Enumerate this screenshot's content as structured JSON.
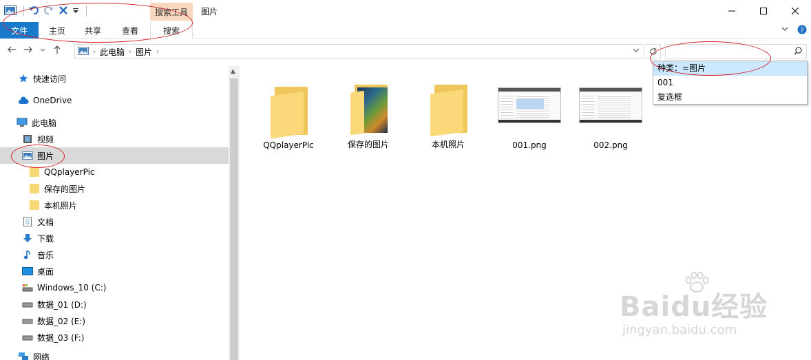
{
  "window": {
    "title": "图片",
    "context_tab_group": "搜索工具",
    "controls": [
      "minimize-icon",
      "maximize-icon",
      "close-icon"
    ]
  },
  "quick_access_toolbar": {
    "icons": [
      "app-icon",
      "undo-icon",
      "redo-icon",
      "delete-icon",
      "customize-dropdown-icon"
    ]
  },
  "ribbon": {
    "tabs": [
      {
        "label": "文件",
        "active": false
      },
      {
        "label": "主页"
      },
      {
        "label": "共享"
      },
      {
        "label": "查看"
      },
      {
        "label": "搜索"
      }
    ],
    "right_icons": [
      "ribbon-expand-icon",
      "help-icon"
    ]
  },
  "address_bar": {
    "crumbs": [
      "此电脑",
      "图片"
    ]
  },
  "search": {
    "value": "",
    "placeholder": ""
  },
  "search_suggestions": [
    {
      "label": "种类：=图片",
      "selected": true
    },
    {
      "label": "001"
    },
    {
      "label": "复选框"
    }
  ],
  "nav_pane": {
    "items": [
      {
        "label": "快速访问",
        "icon": "star-icon"
      },
      {
        "label": "OneDrive",
        "icon": "cloud-icon"
      },
      {
        "label": "此电脑",
        "icon": "computer-icon"
      },
      {
        "label": "视频",
        "icon": "video-icon"
      },
      {
        "label": "图片",
        "icon": "pictures-icon",
        "selected": true
      },
      {
        "label": "QQplayerPic",
        "icon": "folder-icon"
      },
      {
        "label": "保存的图片",
        "icon": "folder-icon"
      },
      {
        "label": "本机照片",
        "icon": "folder-icon"
      },
      {
        "label": "文档",
        "icon": "document-icon"
      },
      {
        "label": "下载",
        "icon": "download-icon"
      },
      {
        "label": "音乐",
        "icon": "music-icon"
      },
      {
        "label": "桌面",
        "icon": "desktop-icon"
      },
      {
        "label": "Windows_10 (C:)",
        "icon": "system-drive-icon"
      },
      {
        "label": "数据_01 (D:)",
        "icon": "drive-icon"
      },
      {
        "label": "数据_02 (E:)",
        "icon": "drive-icon"
      },
      {
        "label": "数据_03 (F:)",
        "icon": "drive-icon"
      },
      {
        "label": "网络",
        "icon": "network-icon"
      }
    ]
  },
  "files": [
    {
      "name": "QQplayerPic",
      "kind": "folder"
    },
    {
      "name": "保存的图片",
      "kind": "picture-folder"
    },
    {
      "name": "本机照片",
      "kind": "folder"
    },
    {
      "name": "001.png",
      "kind": "png"
    },
    {
      "name": "002.png",
      "kind": "png"
    }
  ],
  "watermark": {
    "main": "Baidu经验",
    "sub": "jingyan.baidu.com"
  },
  "colors": {
    "file_tab": "#1979ca",
    "context_tab": "#f8d9c0",
    "selection": "#cce8ff",
    "nav_selected": "#d9d9d9",
    "annotation": "#d2232a"
  }
}
